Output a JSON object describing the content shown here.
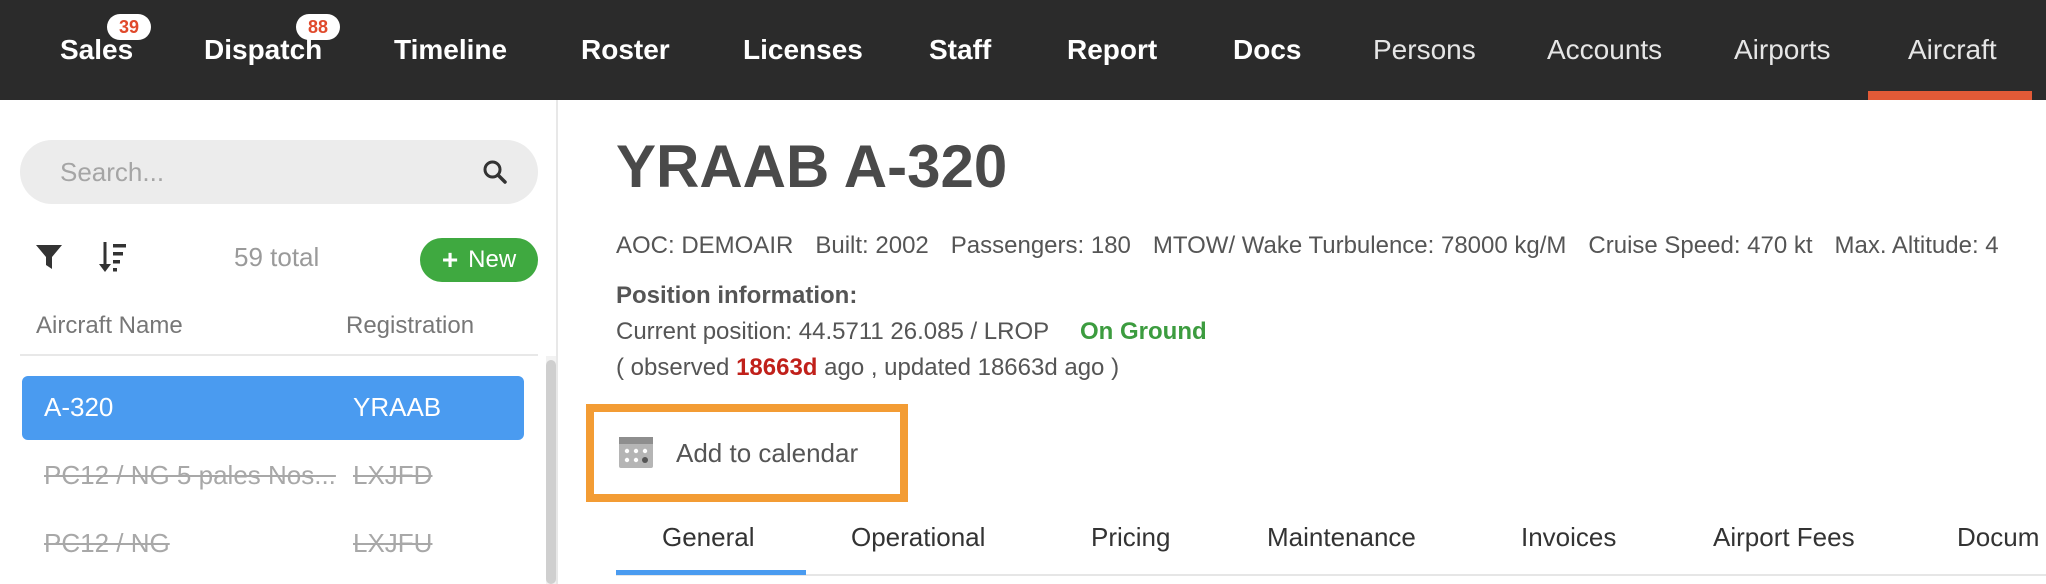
{
  "nav": {
    "items": [
      {
        "label": "Sales",
        "badge": "39"
      },
      {
        "label": "Dispatch",
        "badge": "88"
      },
      {
        "label": "Timeline"
      },
      {
        "label": "Roster"
      },
      {
        "label": "Licenses"
      },
      {
        "label": "Staff"
      },
      {
        "label": "Report"
      },
      {
        "label": "Docs"
      },
      {
        "label": "Persons"
      },
      {
        "label": "Accounts"
      },
      {
        "label": "Airports"
      },
      {
        "label": "Aircraft",
        "active": true
      }
    ],
    "active_color": "#e25a37"
  },
  "sidebar": {
    "search_placeholder": "Search...",
    "total": "59 total",
    "new_label": "New",
    "columns": [
      "Aircraft Name",
      "Registration"
    ],
    "rows": [
      {
        "name": "A-320",
        "registration": "YRAAB",
        "selected": true
      },
      {
        "name": "PC12 / NG 5 pales Nos...",
        "registration": "LXJFD",
        "inactive": true
      },
      {
        "name": "PC12 / NG",
        "registration": "LXJFU",
        "inactive": true
      }
    ]
  },
  "aircraft": {
    "title": "YRAAB A-320",
    "specs": [
      "AOC: DEMOAIR",
      "Built: 2002",
      "Passengers: 180",
      "MTOW/ Wake Turbulence: 78000 kg/M",
      "Cruise Speed: 470 kt",
      "Max. Altitude: 4"
    ],
    "position": {
      "heading": "Position information:",
      "current": "Current position: 44.5711 26.085 / LROP",
      "status": "On Ground",
      "observed_prefix": "( observed ",
      "observed_value": "18663d",
      "observed_suffix": " ago , updated 18663d ago )"
    },
    "add_to_calendar": "Add to calendar"
  },
  "tabs": [
    {
      "label": "General",
      "active": true
    },
    {
      "label": "Operational"
    },
    {
      "label": "Pricing"
    },
    {
      "label": "Maintenance"
    },
    {
      "label": "Invoices"
    },
    {
      "label": "Airport Fees"
    },
    {
      "label": "Docum"
    }
  ]
}
